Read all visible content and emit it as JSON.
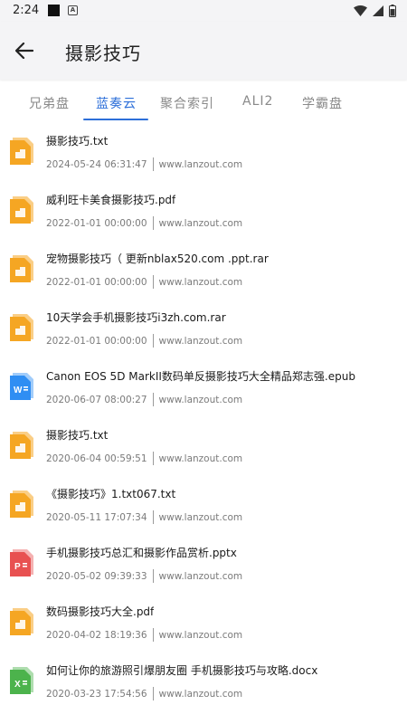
{
  "status_bar": {
    "time": "2:24",
    "battery_label": "battery-icon"
  },
  "app_bar": {
    "title": "摄影技巧"
  },
  "tabs": [
    {
      "label": "兄弟盘",
      "active": false
    },
    {
      "label": "蓝奏云",
      "active": true
    },
    {
      "label": "聚合索引",
      "active": false
    },
    {
      "label": "ALI2",
      "active": false
    },
    {
      "label": "学霸盘",
      "active": false
    }
  ],
  "colors": {
    "accent": "#2d6fd9",
    "folder": "#f5a623",
    "word": "#2f8ef3",
    "ppt": "#e85151",
    "excel": "#4cb34c"
  },
  "files": [
    {
      "name": "摄影技巧.txt",
      "date": "2024-05-24 06:31:47",
      "source": "www.lanzout.com",
      "icon": "archive-file-icon"
    },
    {
      "name": "威利旺卡美食摄影技巧.pdf",
      "date": "2022-01-01 00:00:00",
      "source": "www.lanzout.com",
      "icon": "archive-file-icon"
    },
    {
      "name": "宠物摄影技巧（ 更新nblax520.com .ppt.rar",
      "date": "2022-01-01 00:00:00",
      "source": "www.lanzout.com",
      "icon": "archive-file-icon"
    },
    {
      "name": "10天学会手机摄影技巧i3zh.com.rar",
      "date": "2022-01-01 00:00:00",
      "source": "www.lanzout.com",
      "icon": "archive-file-icon"
    },
    {
      "name": "Canon EOS 5D MarkII数码单反摄影技巧大全精品郑志强.epub",
      "date": "2020-06-07 08:00:27",
      "source": "www.lanzout.com",
      "icon": "word-file-icon"
    },
    {
      "name": "摄影技巧.txt",
      "date": "2020-06-04 00:59:51",
      "source": "www.lanzout.com",
      "icon": "archive-file-icon"
    },
    {
      "name": "《摄影技巧》1.txt067.txt",
      "date": "2020-05-11 17:07:34",
      "source": "www.lanzout.com",
      "icon": "archive-file-icon"
    },
    {
      "name": "手机摄影技巧总汇和摄影作品赏析.pptx",
      "date": "2020-05-02 09:39:33",
      "source": "www.lanzout.com",
      "icon": "ppt-file-icon"
    },
    {
      "name": "数码摄影技巧大全.pdf",
      "date": "2020-04-02 18:19:36",
      "source": "www.lanzout.com",
      "icon": "archive-file-icon"
    },
    {
      "name": "如何让你的旅游照引爆朋友圈 手机摄影技巧与攻略.docx",
      "date": "2020-03-23 17:54:56",
      "source": "www.lanzout.com",
      "icon": "excel-file-icon"
    }
  ]
}
